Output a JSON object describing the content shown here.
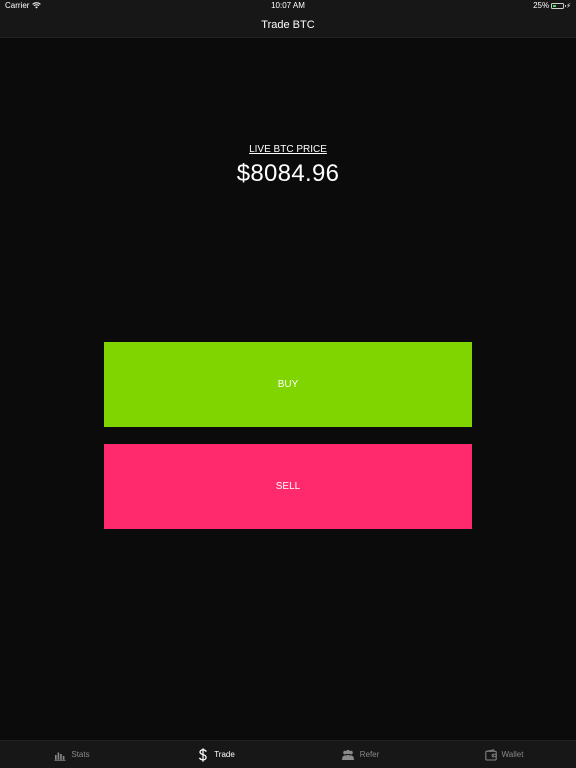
{
  "status_bar": {
    "carrier": "Carrier",
    "time": "10:07 AM",
    "battery": "25%",
    "battery_level": 0.25
  },
  "nav": {
    "title": "Trade BTC"
  },
  "price": {
    "label": "LIVE BTC PRICE",
    "value": "$8084.96"
  },
  "actions": {
    "buy_label": "BUY",
    "sell_label": "SELL"
  },
  "tabs": [
    {
      "label": "Stats",
      "icon": "bar-chart-icon",
      "active": false
    },
    {
      "label": "Trade",
      "icon": "dollar-icon",
      "active": true
    },
    {
      "label": "Refer",
      "icon": "people-icon",
      "active": false
    },
    {
      "label": "Wallet",
      "icon": "wallet-icon",
      "active": false
    }
  ],
  "colors": {
    "background": "#0b0b0b",
    "bar": "#171717",
    "buy": "#80d400",
    "sell": "#ff2a6d",
    "tab_inactive": "#8a8a8a",
    "tab_active": "#ffffff"
  }
}
